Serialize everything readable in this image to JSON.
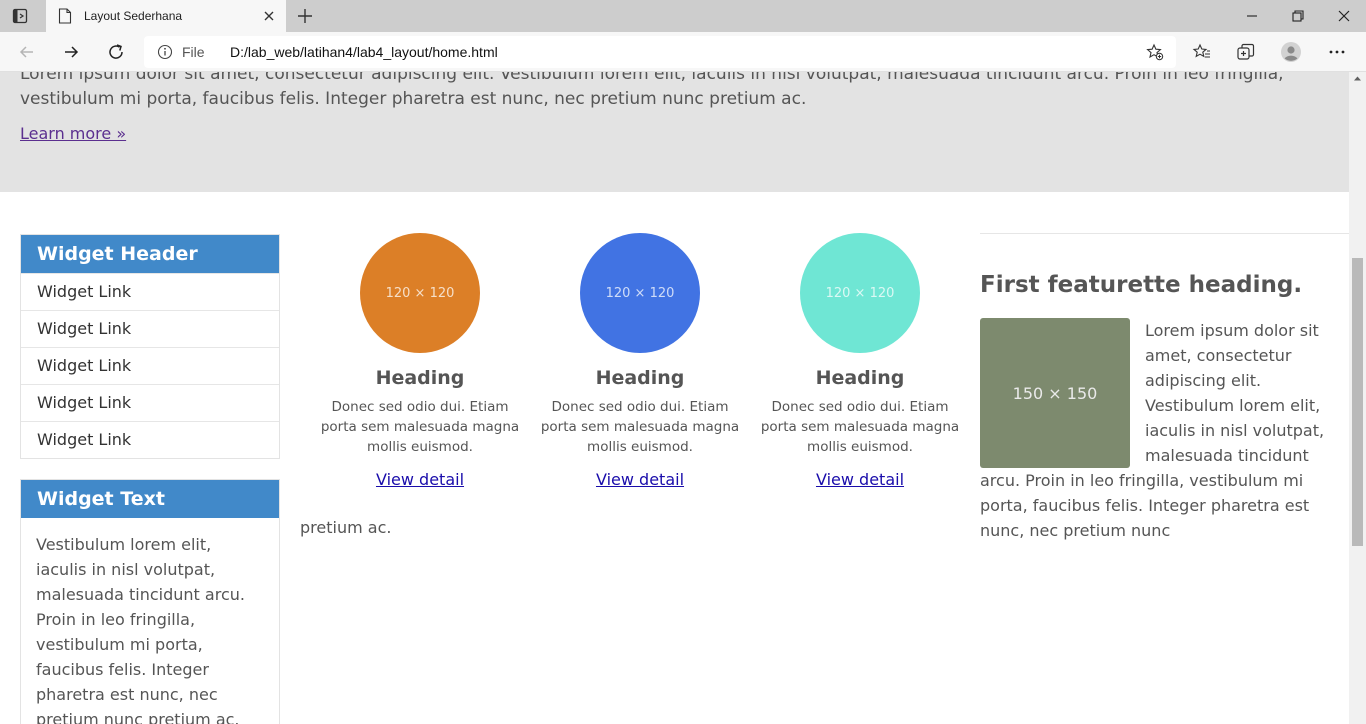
{
  "browser": {
    "tab_title": "Layout Sederhana",
    "url_scheme": "File",
    "url": "D:/lab_web/latihan4/lab4_layout/home.html"
  },
  "jumbotron": {
    "text": "Lorem ipsum dolor sit amet, consectetur adipiscing elit. Vestibulum lorem elit, iaculis in nisl volutpat, malesuada tincidunt arcu. Proin in leo fringilla, vestibulum mi porta, faucibus felis. Integer pharetra est nunc, nec pretium nunc pretium ac.",
    "link": "Learn more »"
  },
  "sidebar": {
    "links_widget": {
      "header": "Widget Header",
      "links": [
        "Widget Link",
        "Widget Link",
        "Widget Link",
        "Widget Link",
        "Widget Link"
      ]
    },
    "text_widget": {
      "header": "Widget Text",
      "body": "Vestibulum lorem elit, iaculis in nisl volutpat, malesuada tincidunt arcu. Proin in leo fringilla, vestibulum mi porta, faucibus felis. Integer pharetra est nunc, nec pretium nunc pretium ac."
    }
  },
  "features": [
    {
      "placeholder": "120 × 120",
      "color": "#dc7f27",
      "heading": "Heading",
      "text": "Donec sed odio dui. Etiam porta sem malesuada magna mollis euismod.",
      "link": "View detail"
    },
    {
      "placeholder": "120 × 120",
      "color": "#4173e3",
      "heading": "Heading",
      "text": "Donec sed odio dui. Etiam porta sem malesuada magna mollis euismod.",
      "link": "View detail"
    },
    {
      "placeholder": "120 × 120",
      "color": "#6fe6d4",
      "heading": "Heading",
      "text": "Donec sed odio dui. Etiam porta sem malesuada magna mollis euismod.",
      "link": "View detail"
    }
  ],
  "featurette": {
    "heading": "First featurette heading.",
    "image_placeholder": "150 × 150",
    "image_color": "#7d8a6e",
    "text": "Lorem ipsum dolor sit amet, consectetur adipiscing elit. Vestibulum lorem elit, iaculis in nisl volutpat, malesuada tincidunt arcu. Proin in leo fringilla, vestibulum mi porta, faucibus felis. Integer pharetra est nunc, nec pretium nunc",
    "overflow_text": "pretium ac."
  }
}
